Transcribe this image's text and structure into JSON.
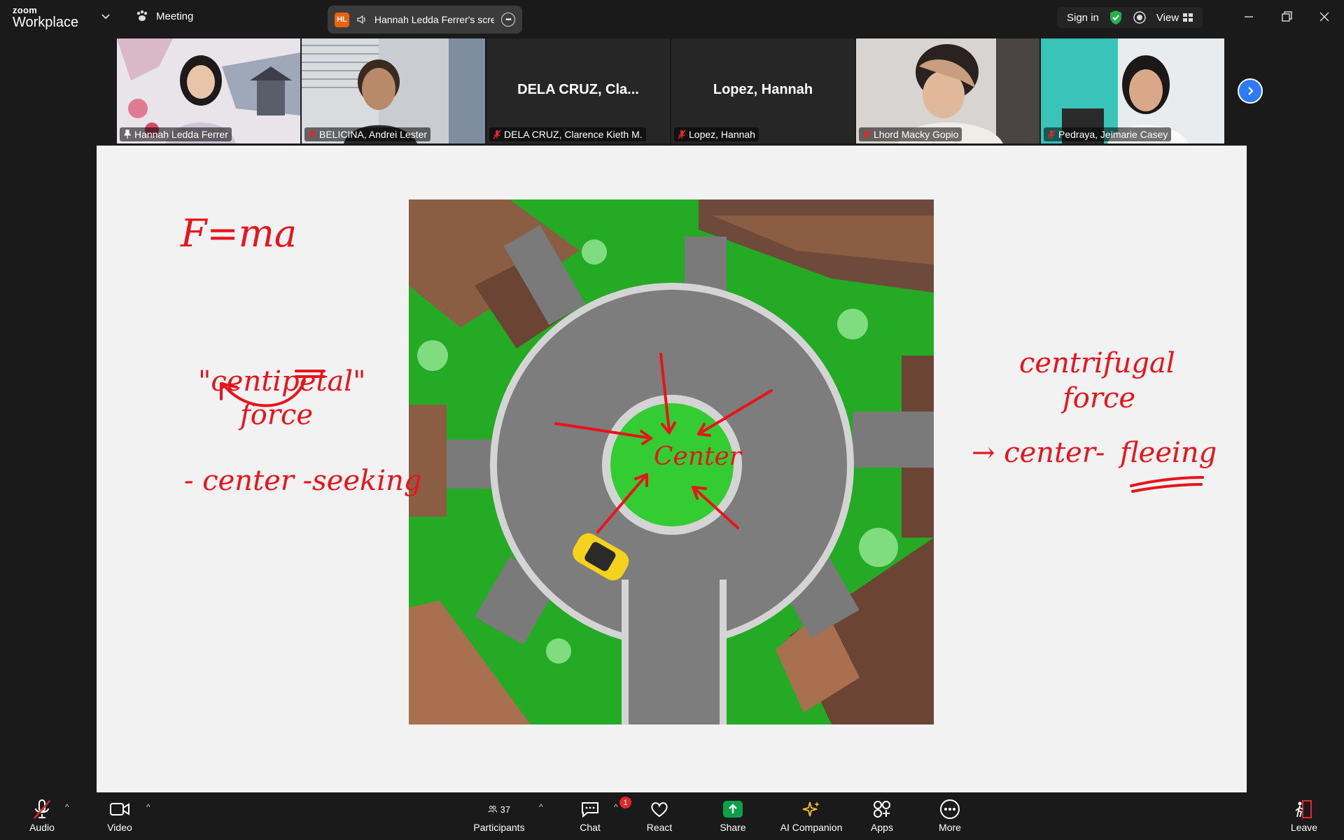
{
  "app": {
    "brand_small": "zoom",
    "brand_big": "Workplace",
    "meeting_label": "Meeting"
  },
  "share_indicator": {
    "initials": "HL",
    "text": "Hannah Ledda Ferrer's scree"
  },
  "top_right": {
    "sign_in": "Sign in",
    "view": "View"
  },
  "participants_strip": [
    {
      "name": "Hannah Ledda Ferrer",
      "center_name": "",
      "muted": false
    },
    {
      "name": "BELICINA, Andrei Lester",
      "center_name": "",
      "muted": true
    },
    {
      "name": "DELA CRUZ, Clarence Kieth M.",
      "center_name": "DELA CRUZ, Cla...",
      "muted": true
    },
    {
      "name": "Lopez, Hannah",
      "center_name": "Lopez, Hannah",
      "muted": true
    },
    {
      "name": "Lhord Macky Gopio",
      "center_name": "",
      "muted": true
    },
    {
      "name": "Pedraya, Jeimarie Casey",
      "center_name": "",
      "muted": true
    }
  ],
  "annotations": {
    "formula": "F=ma",
    "centripetal": "\"centipetal\"",
    "force_left": "force",
    "center_seeking": "- center -seeking",
    "centrifugal": "centrifugal",
    "force_right": "force",
    "center_fleeing_prefix": "→ center-",
    "fleeing": "fleeing",
    "center_label": "Center"
  },
  "toolbar": {
    "audio": "Audio",
    "video": "Video",
    "participants": "Participants",
    "participants_count": "37",
    "chat": "Chat",
    "chat_badge": "1",
    "react": "React",
    "share": "Share",
    "ai_companion": "AI Companion",
    "apps": "Apps",
    "more": "More",
    "leave": "Leave"
  },
  "colors": {
    "annotation_red": "#e8141c",
    "share_green": "#0e9f4a",
    "active_tile": "#38e0a6",
    "nav_blue": "#2d7cf6"
  }
}
